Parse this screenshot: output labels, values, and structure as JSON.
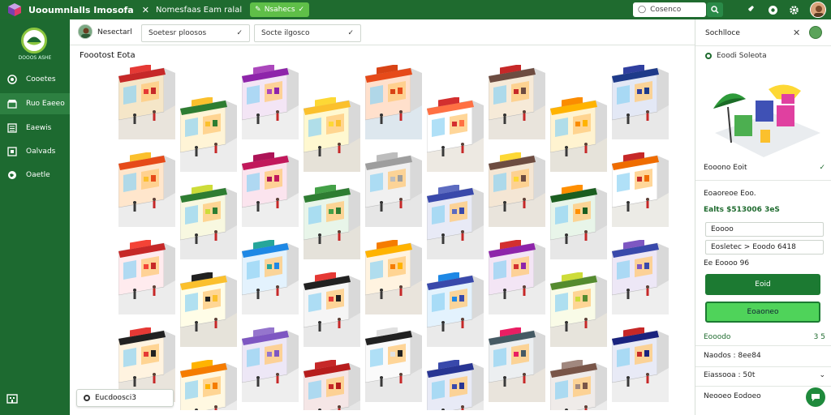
{
  "window": {
    "app_title": "Uooumnlalls Imosofa",
    "tab_title": "Nomesfaas Eam ralal",
    "tab_pill_label": "Nsahecs",
    "search_placeholder": "Cosenco"
  },
  "sidebar": {
    "logo_text": "DOOOS ASHE",
    "items": [
      {
        "label": "Cooetes",
        "icon": "circle-icon",
        "active": false
      },
      {
        "label": "Ruo Eaeeo",
        "icon": "store-icon",
        "active": true
      },
      {
        "label": "Eaewis",
        "icon": "list-icon",
        "active": false
      },
      {
        "label": "Oalvads",
        "icon": "box-icon",
        "active": false
      },
      {
        "label": "Oaetle",
        "icon": "globe-icon",
        "active": false
      }
    ]
  },
  "toolbar": {
    "user_label": "Nesectarl",
    "dropdown1": "Soetesr ploosos",
    "dropdown2": "Socte ilgosco"
  },
  "content": {
    "section_title": "Foootost Eota",
    "bottom_chip": "Eucdoosci3"
  },
  "right_panel": {
    "title": "Sochlloce",
    "subtitle": "Eoodi Soleota",
    "status_label": "Eooono Eoit",
    "row1_label": "Eoaoreoe Eoo.",
    "price": "Ealts $513006 3eS",
    "field1": "Eoooo",
    "field2": "Eosletec > Eoodo 6418",
    "row2_label": "Ee Eoooo 96",
    "btn_primary": "Eoid",
    "btn_secondary": "Eoaoneo",
    "row3_label": "Eooodo",
    "row3_value": "3 5",
    "row4_label": "Naodos : 8ee84",
    "row5_label": "Eiassooa : 50t",
    "row6_label": "Neooeo Eodoeo"
  },
  "colors": {
    "topbar": "#1f6b2f",
    "sidebar": "#1d6a30",
    "accent": "#4fd35a",
    "primary_button": "#1c7a32"
  },
  "stores": [
    {
      "awning": "#c62828",
      "sign": "#e53935",
      "wall": "#f5e6c8",
      "floor": "#e9e4dc"
    },
    {
      "awning": "#2e7d32",
      "sign": "#fbc02d",
      "wall": "#fff4d6",
      "floor": "#ececec"
    },
    {
      "awning": "#8e24aa",
      "sign": "#ab47bc",
      "wall": "#f3e5f5",
      "floor": "#eee"
    },
    {
      "awning": "#fbc02d",
      "sign": "#fdd835",
      "wall": "#fff8d0",
      "floor": "#e6e2d8"
    },
    {
      "awning": "#e64a19",
      "sign": "#d84315",
      "wall": "#ffe0cc",
      "floor": "#dde7ee"
    },
    {
      "awning": "#ff7043",
      "sign": "#d32f2f",
      "wall": "#fff",
      "floor": "#ede9e2"
    },
    {
      "awning": "#6d4c41",
      "sign": "#c62828",
      "wall": "#f6ead8",
      "floor": "#e9e4dc"
    },
    {
      "awning": "#ffb300",
      "sign": "#fb8c00",
      "wall": "#fff3d0",
      "floor": "#e6e3da"
    },
    {
      "awning": "#1e3a8a",
      "sign": "#303f9f",
      "wall": "#e3e8f5",
      "floor": "#e8e8e8"
    },
    {
      "awning": "#e64a19",
      "sign": "#fbc02d",
      "wall": "#ffe6cc",
      "floor": "#ececec"
    },
    {
      "awning": "#2e7d32",
      "sign": "#cddc39",
      "wall": "#f8f8e0",
      "floor": "#e9e9e9"
    },
    {
      "awning": "#c2185b",
      "sign": "#ad1457",
      "wall": "#fbe4ee",
      "floor": "#eee"
    },
    {
      "awning": "#2e7d32",
      "sign": "#43a047",
      "wall": "#e8f5e9",
      "floor": "#e5e2da"
    },
    {
      "awning": "#9e9e9e",
      "sign": "#bdbdbd",
      "wall": "#f0f0f0",
      "floor": "#e6e6e6"
    },
    {
      "awning": "#3949ab",
      "sign": "#5c6bc0",
      "wall": "#e8eaf6",
      "floor": "#e9e9e9"
    },
    {
      "awning": "#6d4c41",
      "sign": "#fdd835",
      "wall": "#f4e6d4",
      "floor": "#e9e4dc"
    },
    {
      "awning": "#1b5e20",
      "sign": "#ff8f00",
      "wall": "#e8f5e9",
      "floor": "#e7e7e7"
    },
    {
      "awning": "#ef6c00",
      "sign": "#c62828",
      "wall": "#fff",
      "floor": "#ecebe6"
    },
    {
      "awning": "#c62828",
      "sign": "#f44336",
      "wall": "#ffebee",
      "floor": "#ececec"
    },
    {
      "awning": "#fbc02d",
      "sign": "#212121",
      "wall": "#fffde7",
      "floor": "#e6e3da"
    },
    {
      "awning": "#1e88e5",
      "sign": "#26a69a",
      "wall": "#e3f2fd",
      "floor": "#eee"
    },
    {
      "awning": "#212121",
      "sign": "#e53935",
      "wall": "#f5f5f5",
      "floor": "#e8e8e8"
    },
    {
      "awning": "#ffb300",
      "sign": "#f57c00",
      "wall": "#fff3e0",
      "floor": "#e9e4dc"
    },
    {
      "awning": "#3949ab",
      "sign": "#1e88e5",
      "wall": "#e3f2fd",
      "floor": "#eaeaea"
    },
    {
      "awning": "#8e24aa",
      "sign": "#d32f2f",
      "wall": "#f3e5f5",
      "floor": "#ececec"
    },
    {
      "awning": "#558b2f",
      "sign": "#cddc39",
      "wall": "#f9fbe7",
      "floor": "#e7e4dc"
    },
    {
      "awning": "#3949ab",
      "sign": "#7e57c2",
      "wall": "#ede7f6",
      "floor": "#eee"
    },
    {
      "awning": "#212121",
      "sign": "#e53935",
      "wall": "#fff3e0",
      "floor": "#e9e4dc"
    },
    {
      "awning": "#f57c00",
      "sign": "#ffb300",
      "wall": "#fff8e1",
      "floor": "#ececec"
    },
    {
      "awning": "#7e57c2",
      "sign": "#9575cd",
      "wall": "#ede7f6",
      "floor": "#eee"
    },
    {
      "awning": "#b71c1c",
      "sign": "#c62828",
      "wall": "#f5e6e6",
      "floor": "#e6e6e6"
    },
    {
      "awning": "#212121",
      "sign": "#e0e0e0",
      "wall": "#fafafa",
      "floor": "#e8e8e8"
    },
    {
      "awning": "#283593",
      "sign": "#3949ab",
      "wall": "#e8eaf6",
      "floor": "#eaeaea"
    },
    {
      "awning": "#455a64",
      "sign": "#e91e63",
      "wall": "#eceff1",
      "floor": "#e9e4dc"
    },
    {
      "awning": "#795548",
      "sign": "#a1887f",
      "wall": "#efebe9",
      "floor": "#ececec"
    },
    {
      "awning": "#1a237e",
      "sign": "#c62828",
      "wall": "#e8eaf6",
      "floor": "#eee"
    }
  ]
}
